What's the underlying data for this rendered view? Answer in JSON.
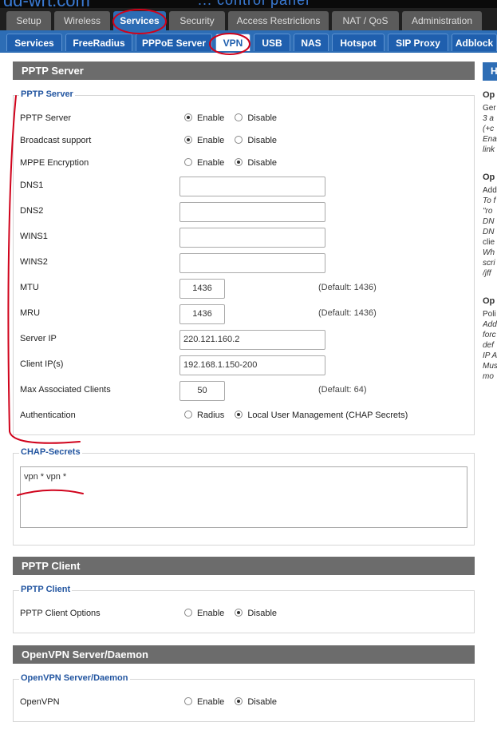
{
  "brand": {
    "logo": "dd-wrt.com",
    "subtitle": "... control panel"
  },
  "main_tabs": [
    "Setup",
    "Wireless",
    "Services",
    "Security",
    "Access Restrictions",
    "NAT / QoS",
    "Administration"
  ],
  "sub_tabs": [
    "Services",
    "FreeRadius",
    "PPPoE Server",
    "VPN",
    "USB",
    "NAS",
    "Hotspot",
    "SIP Proxy",
    "Adblock"
  ],
  "pptp_server": {
    "section_title": "PPTP Server",
    "legend": "PPTP Server",
    "radio_enable": "Enable",
    "radio_disable": "Disable",
    "rows": {
      "pptp_server": {
        "label": "PPTP Server",
        "value": "Enable"
      },
      "broadcast": {
        "label": "Broadcast support",
        "value": "Enable"
      },
      "mppe": {
        "label": "MPPE Encryption",
        "value": "Disable"
      }
    },
    "dns1": {
      "label": "DNS1",
      "value": ""
    },
    "dns2": {
      "label": "DNS2",
      "value": ""
    },
    "wins1": {
      "label": "WINS1",
      "value": ""
    },
    "wins2": {
      "label": "WINS2",
      "value": ""
    },
    "mtu": {
      "label": "MTU",
      "value": "1436",
      "hint": "(Default: 1436)"
    },
    "mru": {
      "label": "MRU",
      "value": "1436",
      "hint": "(Default: 1436)"
    },
    "server_ip": {
      "label": "Server IP",
      "value": "220.121.160.2"
    },
    "client_ips": {
      "label": "Client IP(s)",
      "value": "192.168.1.150-200"
    },
    "max_clients": {
      "label": "Max Associated Clients",
      "value": "50",
      "hint": "(Default: 64)"
    },
    "auth": {
      "label": "Authentication",
      "opt1": "Radius",
      "opt2": "Local User Management (CHAP Secrets)",
      "value": "Local User Management (CHAP Secrets)"
    }
  },
  "chap": {
    "legend": "CHAP-Secrets",
    "value": "vpn * vpn *"
  },
  "pptp_client": {
    "section_title": "PPTP Client",
    "legend": "PPTP Client",
    "options_label": "PPTP Client Options",
    "value": "Disable"
  },
  "openvpn": {
    "section_title": "OpenVPN Server/Daemon",
    "legend": "OpenVPN Server/Daemon",
    "label": "OpenVPN",
    "value": "Disable"
  },
  "help_panel": {
    "title": "H",
    "lines": [
      "Op",
      "Ger",
      "3 a",
      "(+c",
      "Ena",
      "link",
      "Op",
      "Add",
      "To f",
      "\"ro",
      "DN",
      "DN",
      "clie",
      "Wh",
      "scri",
      "/jff",
      "Op",
      "Poli",
      "Add",
      "forc",
      "def",
      "IP A",
      "Mus",
      "mo"
    ]
  },
  "colors": {
    "accent": "#2d6db5",
    "section_bar": "#6c6c6c",
    "legend": "#2255a0",
    "annotation": "#d0021b"
  }
}
